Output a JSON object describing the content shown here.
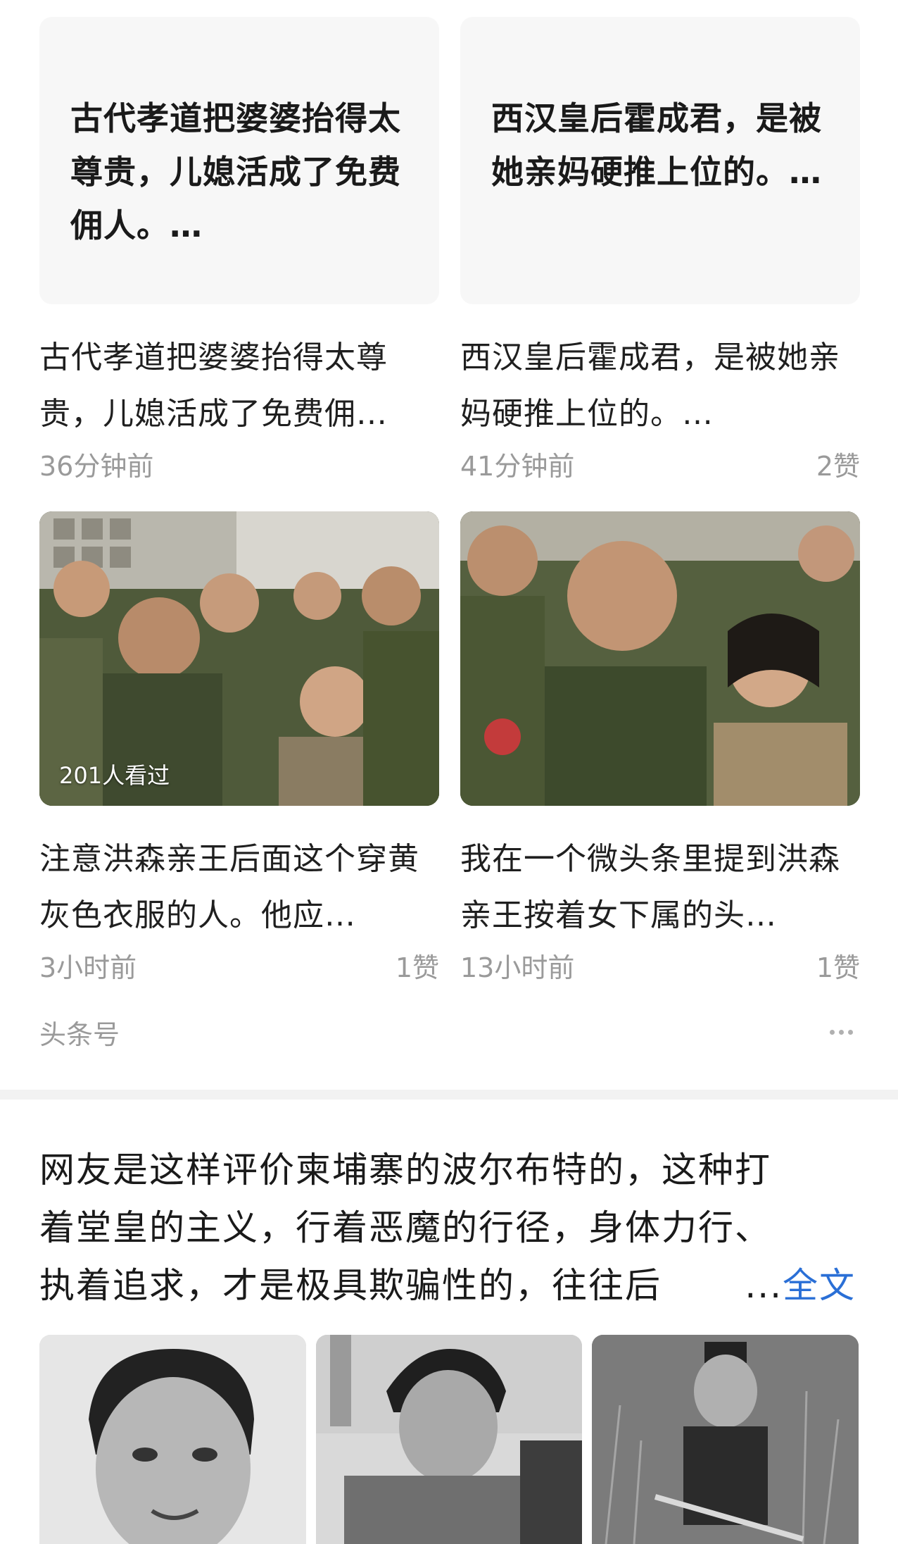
{
  "cards": [
    {
      "cover_text": "古代孝道把婆婆抬得太尊贵，儿媳活成了免费佣人。…",
      "title": "古代孝道把婆婆抬得太尊贵，儿媳活成了免费佣…",
      "time": "36分钟前",
      "likes": ""
    },
    {
      "cover_text": "西汉皇后霍成君，是被她亲妈硬推上位的。…",
      "title": "西汉皇后霍成君，是被她亲妈硬推上位的。…",
      "time": "41分钟前",
      "likes": "2赞"
    },
    {
      "views": "201人看过",
      "title": "注意洪森亲王后面这个穿黄灰色衣服的人。他应…",
      "time": "3小时前",
      "likes": "1赞"
    },
    {
      "title": "我在一个微头条里提到洪森亲王按着女下属的头…",
      "time": "13小时前",
      "likes": "1赞"
    }
  ],
  "source": "头条号",
  "more_icon": "more-dots-icon",
  "post": {
    "line1": "网友是这样评价柬埔寨的波尔布特的，这种打",
    "line2": "着堂皇的主义，行着恶魔的行径，身体力行、",
    "line3": "执着追求，才是极具欺骗性的，往往后",
    "ellipsis": "...",
    "full_link": "全文"
  },
  "colors": {
    "link": "#2a6fd6",
    "meta": "#9a9a9a",
    "cover_bg": "#f7f7f7"
  }
}
